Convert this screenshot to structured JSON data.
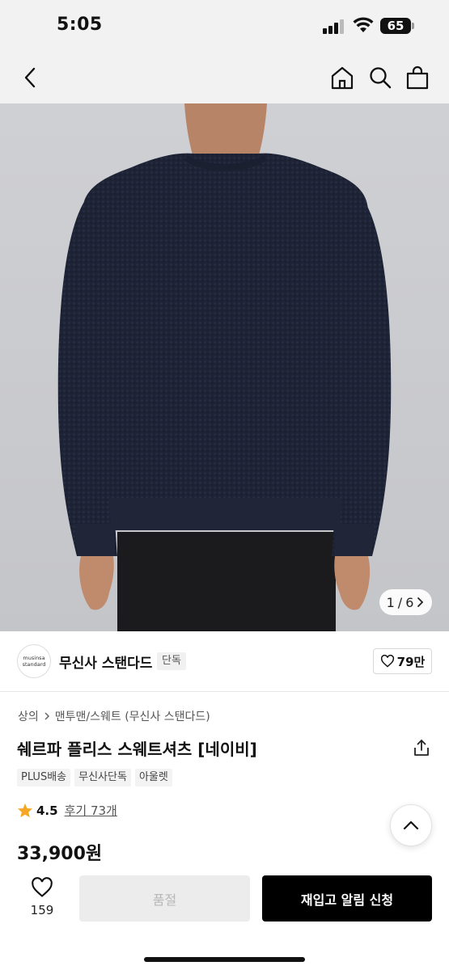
{
  "status_bar": {
    "time": "5:05",
    "battery": "65"
  },
  "nav": {
    "back_icon": "chevron-left-icon",
    "home_icon": "home-icon",
    "search_icon": "search-icon",
    "bag_icon": "shopping-bag-icon"
  },
  "gallery": {
    "current": "1",
    "separator": "/",
    "total": "6"
  },
  "brand": {
    "logo_line1": "musinsa",
    "logo_line2": "standard",
    "name": "무신사 스탠다드",
    "badge": "단독",
    "likes": "79만"
  },
  "product": {
    "breadcrumb": [
      "상의",
      "맨투맨/스웨트 (무신사 스탠다드)"
    ],
    "title": "쉐르파 플리스 스웨트셔츠 [네이비]",
    "tags": [
      "PLUS배송",
      "무신사단독",
      "아울렛"
    ],
    "rating": "4.5",
    "review_label": "후기 73개",
    "price": "33,900원"
  },
  "bottom": {
    "wish_count": "159",
    "soldout_label": "품절",
    "restock_label": "재입고 알림 신청"
  },
  "colors": {
    "sweater": "#1e2436",
    "background": "#c9cace",
    "star": "#f5a623",
    "cta": "#000000"
  }
}
